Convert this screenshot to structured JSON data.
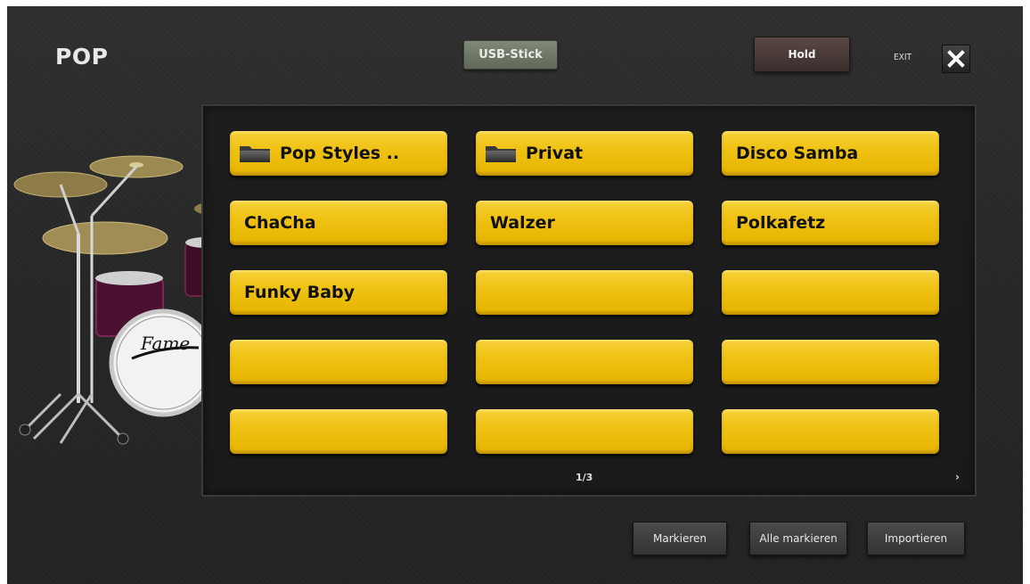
{
  "header": {
    "title": "POP",
    "usb_label": "USB-Stick",
    "hold_label": "Hold",
    "exit_label": "EXIT"
  },
  "items": [
    {
      "label": "Pop Styles ..",
      "type": "folder"
    },
    {
      "label": "Privat",
      "type": "folder"
    },
    {
      "label": "Disco Samba",
      "type": "style"
    },
    {
      "label": "ChaCha",
      "type": "style"
    },
    {
      "label": "Walzer",
      "type": "style"
    },
    {
      "label": "Polkafetz",
      "type": "style"
    },
    {
      "label": "Funky Baby",
      "type": "style"
    },
    {
      "label": "",
      "type": "empty"
    },
    {
      "label": "",
      "type": "empty"
    },
    {
      "label": "",
      "type": "empty"
    },
    {
      "label": "",
      "type": "empty"
    },
    {
      "label": "",
      "type": "empty"
    },
    {
      "label": "",
      "type": "empty"
    },
    {
      "label": "",
      "type": "empty"
    },
    {
      "label": "",
      "type": "empty"
    }
  ],
  "pagination": {
    "indicator": "1/3",
    "next_icon": "chevron-right-icon"
  },
  "footer": {
    "mark_label": "Markieren",
    "mark_all_label": "Alle markieren",
    "import_label": "Importieren"
  },
  "colors": {
    "button_yellow": "#f0c214",
    "background": "#2a2a2a"
  }
}
